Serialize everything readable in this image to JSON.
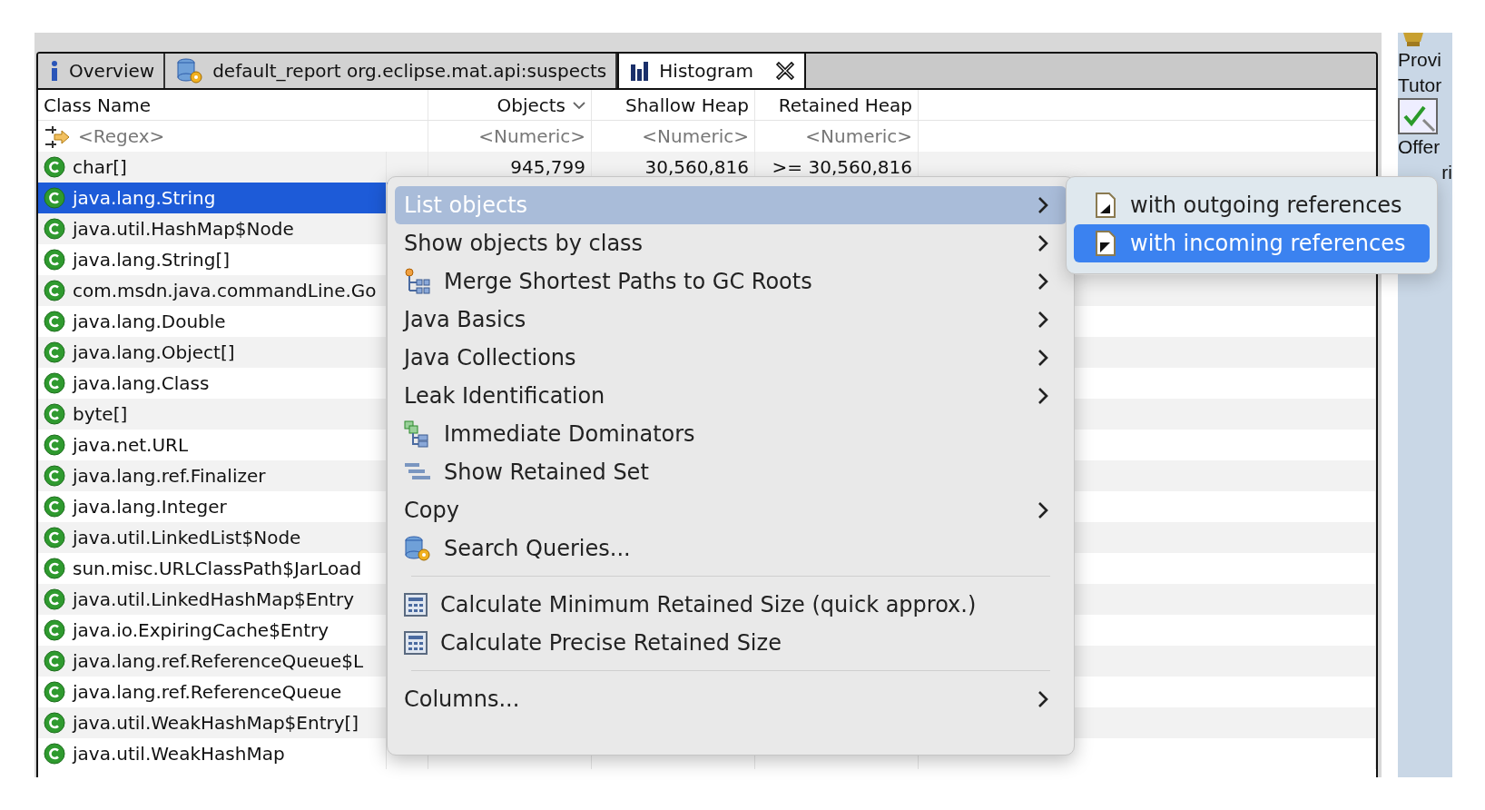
{
  "tabs": [
    {
      "label": "Overview",
      "selected": false,
      "closable": false
    },
    {
      "label": "default_report  org.eclipse.mat.api:suspects",
      "selected": false,
      "closable": false
    },
    {
      "label": "Histogram",
      "selected": true,
      "closable": true
    }
  ],
  "table": {
    "columns": [
      {
        "label": "Class Name",
        "sorted": false
      },
      {
        "label": "Objects",
        "sorted": true
      },
      {
        "label": "Shallow Heap",
        "sorted": false
      },
      {
        "label": "Retained Heap",
        "sorted": false
      }
    ],
    "filters": [
      "<Regex>",
      "<Numeric>",
      "<Numeric>",
      "<Numeric>"
    ],
    "rows": [
      {
        "name": "char[]",
        "objects": "945,799",
        "shallow_heap": "30,560,816",
        "retained_heap": ">= 30,560,816",
        "selected": false
      },
      {
        "name": "java.lang.String",
        "selected": true
      },
      {
        "name": "java.util.HashMap$Node",
        "selected": false
      },
      {
        "name": "java.lang.String[]",
        "selected": false
      },
      {
        "name": "com.msdn.java.commandLine.Go",
        "selected": false
      },
      {
        "name": "java.lang.Double",
        "selected": false
      },
      {
        "name": "java.lang.Object[]",
        "selected": false
      },
      {
        "name": "java.lang.Class",
        "selected": false
      },
      {
        "name": "byte[]",
        "selected": false
      },
      {
        "name": "java.net.URL",
        "selected": false
      },
      {
        "name": "java.lang.ref.Finalizer",
        "selected": false
      },
      {
        "name": "java.lang.Integer",
        "selected": false
      },
      {
        "name": "java.util.LinkedList$Node",
        "selected": false
      },
      {
        "name": "sun.misc.URLClassPath$JarLoad",
        "selected": false
      },
      {
        "name": "java.util.LinkedHashMap$Entry",
        "selected": false
      },
      {
        "name": "java.io.ExpiringCache$Entry",
        "selected": false
      },
      {
        "name": "java.lang.ref.ReferenceQueue$L",
        "selected": false
      },
      {
        "name": "java.lang.ref.ReferenceQueue",
        "selected": false
      },
      {
        "name": "java.util.WeakHashMap$Entry[]",
        "selected": false
      },
      {
        "name": "java.util.WeakHashMap",
        "selected": false
      }
    ]
  },
  "side_panel": {
    "texts": [
      "Provi",
      "Tutor",
      "Offer",
      "ri"
    ]
  },
  "context_menu": {
    "items": [
      {
        "kind": "item",
        "label": "List objects",
        "submenu": true,
        "selected": true
      },
      {
        "kind": "item",
        "label": "Show objects by class",
        "submenu": true,
        "selected": false
      },
      {
        "kind": "item",
        "label": "Merge Shortest Paths to GC Roots",
        "submenu": true,
        "selected": false
      },
      {
        "kind": "item",
        "label": "Java Basics",
        "submenu": true,
        "selected": false
      },
      {
        "kind": "item",
        "label": "Java Collections",
        "submenu": true,
        "selected": false
      },
      {
        "kind": "item",
        "label": "Leak Identification",
        "submenu": true,
        "selected": false
      },
      {
        "kind": "item",
        "label": "Immediate Dominators",
        "submenu": false,
        "selected": false
      },
      {
        "kind": "item",
        "label": "Show Retained Set",
        "submenu": false,
        "selected": false
      },
      {
        "kind": "item",
        "label": "Copy",
        "submenu": true,
        "selected": false
      },
      {
        "kind": "item",
        "label": "Search Queries...",
        "submenu": false,
        "selected": false
      },
      {
        "kind": "separator"
      },
      {
        "kind": "item",
        "label": "Calculate Minimum Retained Size (quick approx.)",
        "submenu": false,
        "selected": false
      },
      {
        "kind": "item",
        "label": "Calculate Precise Retained Size",
        "submenu": false,
        "selected": false
      },
      {
        "kind": "separator"
      },
      {
        "kind": "item",
        "label": "Columns...",
        "submenu": true,
        "selected": false
      }
    ]
  },
  "submenu": {
    "items": [
      {
        "label": "with outgoing references",
        "selected": false
      },
      {
        "label": "with incoming references",
        "selected": true
      }
    ]
  }
}
